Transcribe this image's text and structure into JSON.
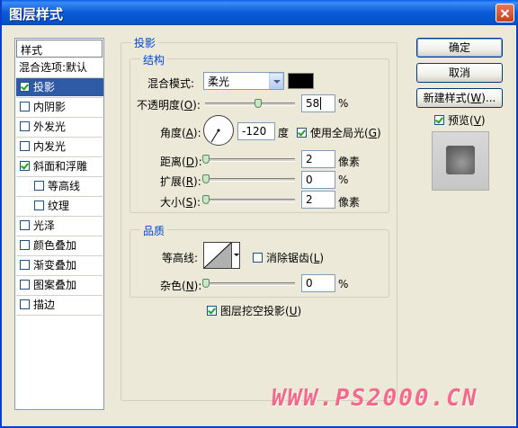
{
  "window": {
    "title": "图层样式"
  },
  "styles_list": {
    "header": "样式",
    "items": [
      {
        "label": "混合选项:默认",
        "checkbox": false,
        "checked": false,
        "selected": false
      },
      {
        "label": "投影",
        "checkbox": true,
        "checked": true,
        "selected": true
      },
      {
        "label": "内阴影",
        "checkbox": true,
        "checked": false,
        "selected": false
      },
      {
        "label": "外发光",
        "checkbox": true,
        "checked": false,
        "selected": false
      },
      {
        "label": "内发光",
        "checkbox": true,
        "checked": false,
        "selected": false
      },
      {
        "label": "斜面和浮雕",
        "checkbox": true,
        "checked": true,
        "selected": false
      },
      {
        "label": "等高线",
        "checkbox": true,
        "checked": false,
        "selected": false,
        "indent": true
      },
      {
        "label": "纹理",
        "checkbox": true,
        "checked": false,
        "selected": false,
        "indent": true
      },
      {
        "label": "光泽",
        "checkbox": true,
        "checked": false,
        "selected": false
      },
      {
        "label": "颜色叠加",
        "checkbox": true,
        "checked": false,
        "selected": false
      },
      {
        "label": "渐变叠加",
        "checkbox": true,
        "checked": false,
        "selected": false
      },
      {
        "label": "图案叠加",
        "checkbox": true,
        "checked": false,
        "selected": false
      },
      {
        "label": "描边",
        "checkbox": true,
        "checked": false,
        "selected": false
      }
    ]
  },
  "drop_shadow": {
    "section_title": "投影",
    "structure": {
      "title": "结构",
      "blend_mode": {
        "label": "混合模式:",
        "value": "柔光",
        "color": "#000000"
      },
      "opacity": {
        "label_pre": "不透明度(",
        "key": "O",
        "label_post": "):",
        "value": "58",
        "unit": "%",
        "slider": 0.58
      },
      "angle": {
        "label_pre": "角度(",
        "key": "A",
        "label_post": "):",
        "value": "-120",
        "unit": "度",
        "global_light": {
          "label_pre": "使用全局光(",
          "key": "G",
          "label_post": ")",
          "checked": true
        }
      },
      "distance": {
        "label_pre": "距离(",
        "key": "D",
        "label_post": "):",
        "value": "2",
        "unit": "像素",
        "slider": 0.0
      },
      "spread": {
        "label_pre": "扩展(",
        "key": "R",
        "label_post": "):",
        "value": "0",
        "unit": "%",
        "slider": 0.0
      },
      "size": {
        "label_pre": "大小(",
        "key": "S",
        "label_post": "):",
        "value": "2",
        "unit": "像素",
        "slider": 0.0
      }
    },
    "quality": {
      "title": "品质",
      "contour": {
        "label": "等高线:"
      },
      "anti_alias": {
        "label_pre": "消除锯齿(",
        "key": "L",
        "label_post": ")",
        "checked": false
      },
      "noise": {
        "label_pre": "杂色(",
        "key": "N",
        "label_post": "):",
        "value": "0",
        "unit": "%",
        "slider": 0.0
      }
    },
    "knockout": {
      "label_pre": "图层挖空投影(",
      "key": "U",
      "label_post": ")",
      "checked": true
    }
  },
  "buttons": {
    "ok": "确定",
    "cancel": "取消",
    "new_style_pre": "新建样式(",
    "new_style_key": "W",
    "new_style_post": ")...",
    "preview_pre": "预览(",
    "preview_key": "V",
    "preview_post": ")",
    "preview_checked": true
  },
  "watermark": "WWW.PS2000.CN"
}
